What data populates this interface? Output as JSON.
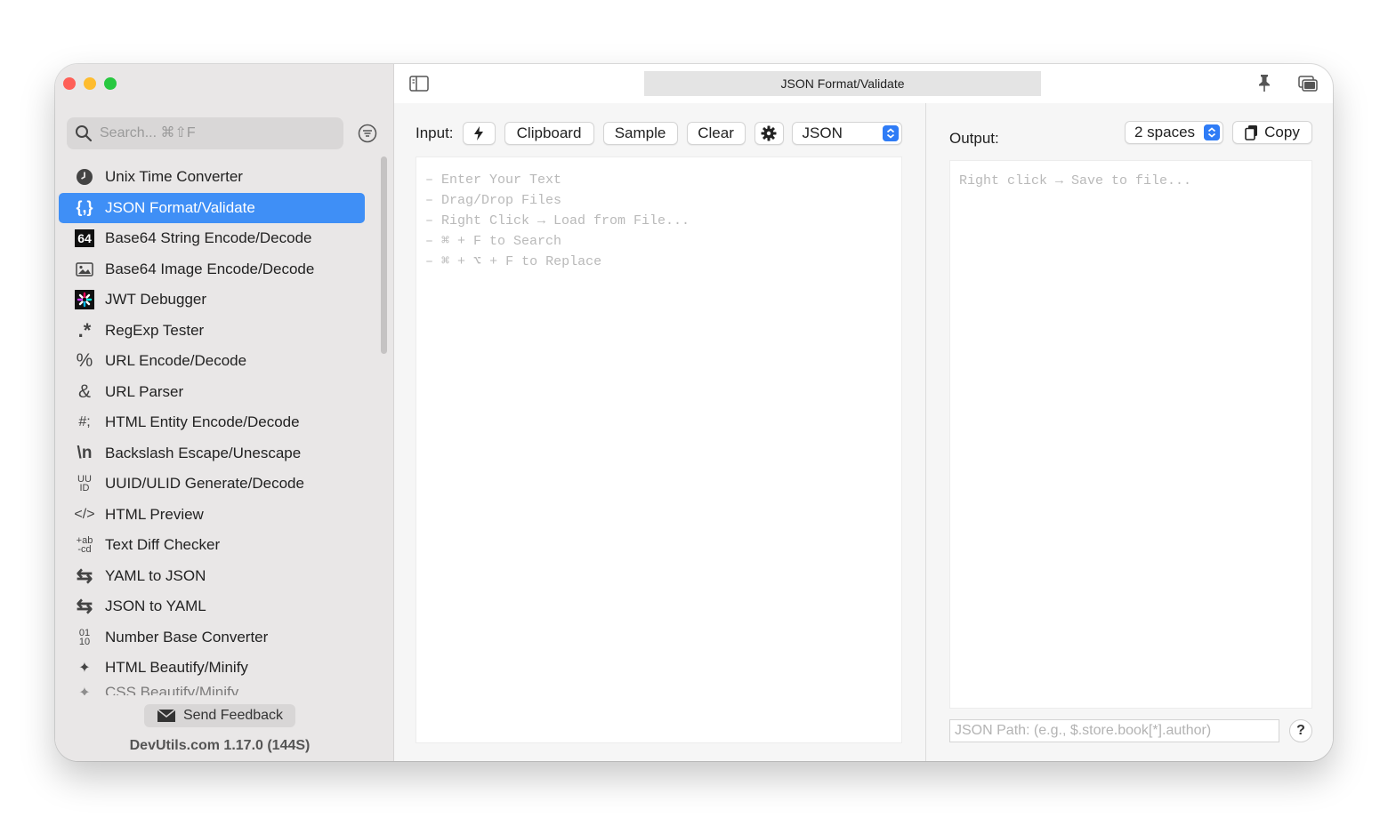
{
  "window": {
    "title": "JSON Format/Validate"
  },
  "sidebar": {
    "search_placeholder": "Search... ⌘⇧F",
    "items": [
      {
        "label": "Unix Time Converter",
        "icon": "clock-icon",
        "glyph": ""
      },
      {
        "label": "JSON Format/Validate",
        "icon": "json-braces-icon",
        "glyph": "{,}",
        "active": true
      },
      {
        "label": "Base64 String Encode/Decode",
        "icon": "base64-icon",
        "glyph": "64"
      },
      {
        "label": "Base64 Image Encode/Decode",
        "icon": "image-icon",
        "glyph": ""
      },
      {
        "label": "JWT Debugger",
        "icon": "jwt-icon",
        "glyph": ""
      },
      {
        "label": "RegExp Tester",
        "icon": "regex-icon",
        "glyph": ".*"
      },
      {
        "label": "URL Encode/Decode",
        "icon": "percent-icon",
        "glyph": "%"
      },
      {
        "label": "URL Parser",
        "icon": "ampersand-icon",
        "glyph": "&"
      },
      {
        "label": "HTML Entity Encode/Decode",
        "icon": "hash-semicolon-icon",
        "glyph": "#;"
      },
      {
        "label": "Backslash Escape/Unescape",
        "icon": "backslash-n-icon",
        "glyph": "\\n"
      },
      {
        "label": "UUID/ULID Generate/Decode",
        "icon": "uuid-icon",
        "glyph": "UU ID"
      },
      {
        "label": "HTML Preview",
        "icon": "code-tag-icon",
        "glyph": "</>"
      },
      {
        "label": "Text Diff Checker",
        "icon": "diff-icon",
        "glyph": "+ab -cd"
      },
      {
        "label": "YAML to JSON",
        "icon": "swap-arrows-icon",
        "glyph": "⇆"
      },
      {
        "label": "JSON to YAML",
        "icon": "swap-arrows-icon",
        "glyph": "⇆"
      },
      {
        "label": "Number Base Converter",
        "icon": "binary-icon",
        "glyph": "01 10"
      },
      {
        "label": "HTML Beautify/Minify",
        "icon": "magic-wand-icon",
        "glyph": "✦"
      },
      {
        "label": "CSS Beautify/Minify",
        "icon": "magic-wand-icon",
        "glyph": "✦",
        "partial": true
      }
    ],
    "feedback_label": "Send Feedback",
    "version": "DevUtils.com 1.17.0 (144S)"
  },
  "input": {
    "label": "Input:",
    "clipboard": "Clipboard",
    "sample": "Sample",
    "clear": "Clear",
    "mode": "JSON",
    "placeholder_lines": [
      "– Enter Your Text",
      "– Drag/Drop Files",
      "– Right Click → Load from File...",
      "– ⌘ + F to Search",
      "– ⌘ + ⌥ + F to Replace"
    ]
  },
  "output": {
    "label": "Output:",
    "indent": "2 spaces",
    "copy": "Copy",
    "placeholder": "Right click → Save to file...",
    "json_path_placeholder": "JSON Path: (e.g., $.store.book[*].author)",
    "help": "?"
  },
  "colors": {
    "accent": "#3f8ff6",
    "select_chevron": "#2f7cf6",
    "sidebar_bg": "#e9e7e7"
  }
}
